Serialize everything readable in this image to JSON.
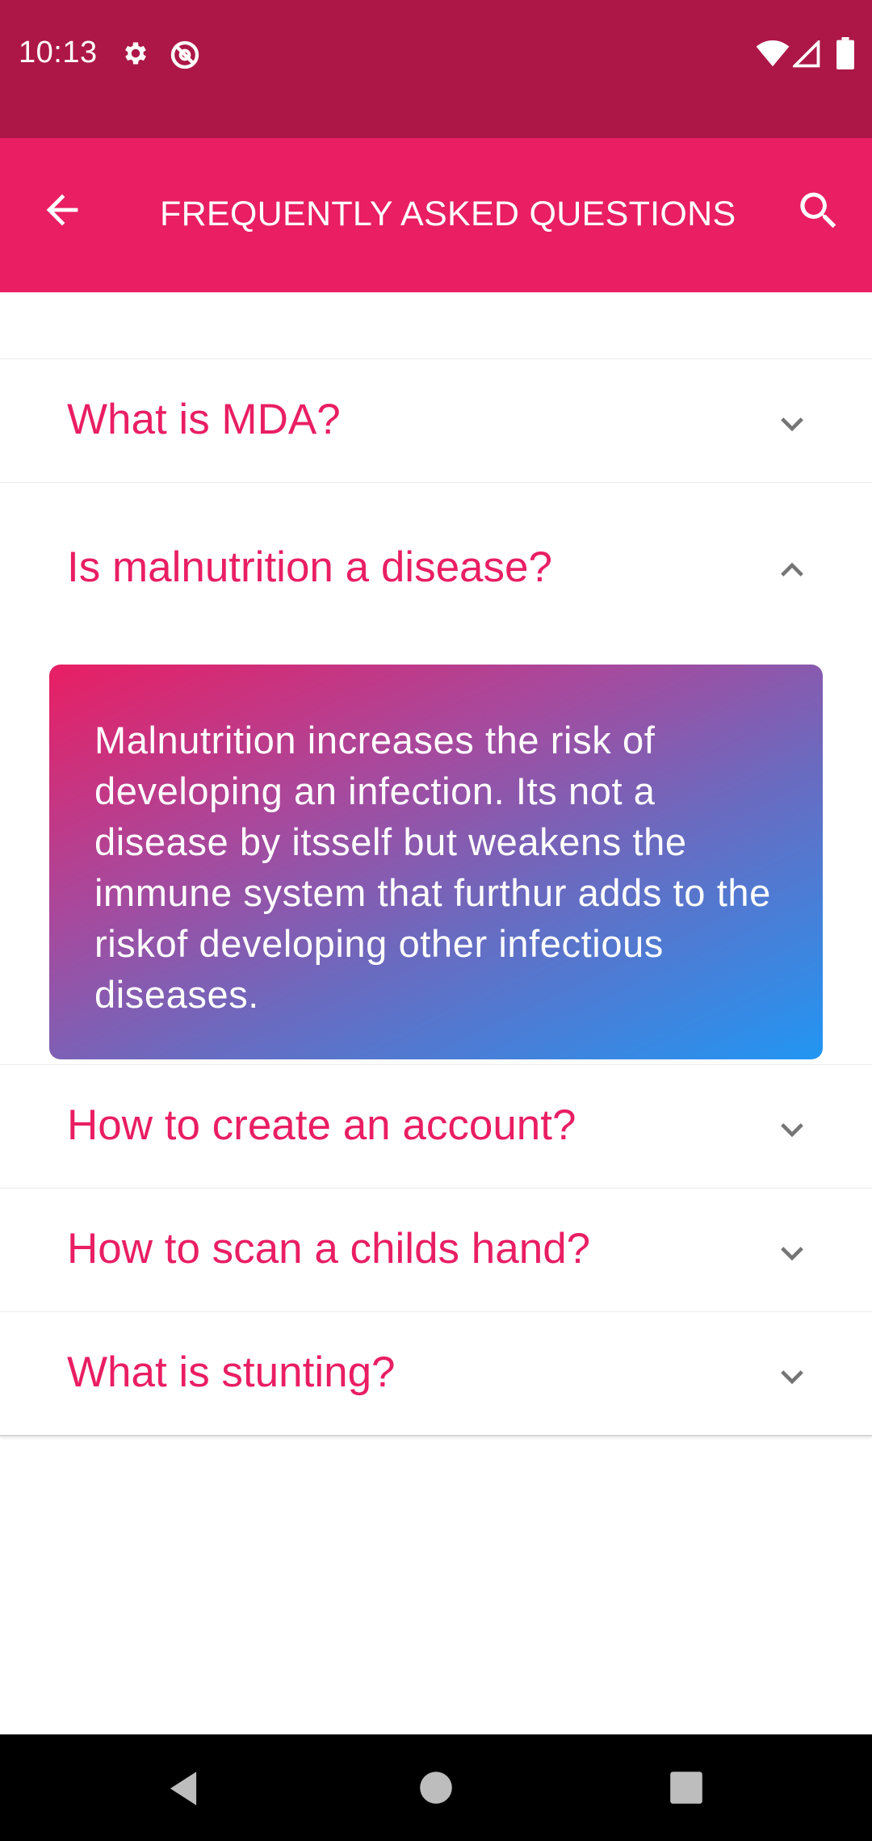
{
  "status_bar": {
    "time": "10:13",
    "icons_left": [
      "gear-icon",
      "no-disturb-icon"
    ],
    "icons_right": [
      "wifi-icon",
      "signal-icon",
      "battery-icon"
    ]
  },
  "toolbar": {
    "title": "FREQUENTLY ASKED QUESTIONS",
    "back_icon": "arrow-left-icon",
    "search_icon": "search-icon",
    "color": "#E91E63"
  },
  "faq": [
    {
      "question": "What is MDA?",
      "expanded": false
    },
    {
      "question": "Is malnutrition a disease?",
      "expanded": true,
      "answer": "Malnutrition increases the risk of developing an infection. Its not a disease by itsself but weakens the immune system that furthur adds to the riskof developing other infectious diseases."
    },
    {
      "question": "How to create an account?",
      "expanded": false
    },
    {
      "question": "How to scan a childs hand?",
      "expanded": false
    },
    {
      "question": "What is stunting?",
      "expanded": false
    }
  ],
  "colors": {
    "status_bar": "#AD1748",
    "accent": "#E91E63",
    "answer_gradient_start": "#E91E63",
    "answer_gradient_end": "#2196F3"
  },
  "nav_bar": {
    "buttons": [
      "back-triangle-icon",
      "home-circle-icon",
      "recents-square-icon"
    ]
  }
}
